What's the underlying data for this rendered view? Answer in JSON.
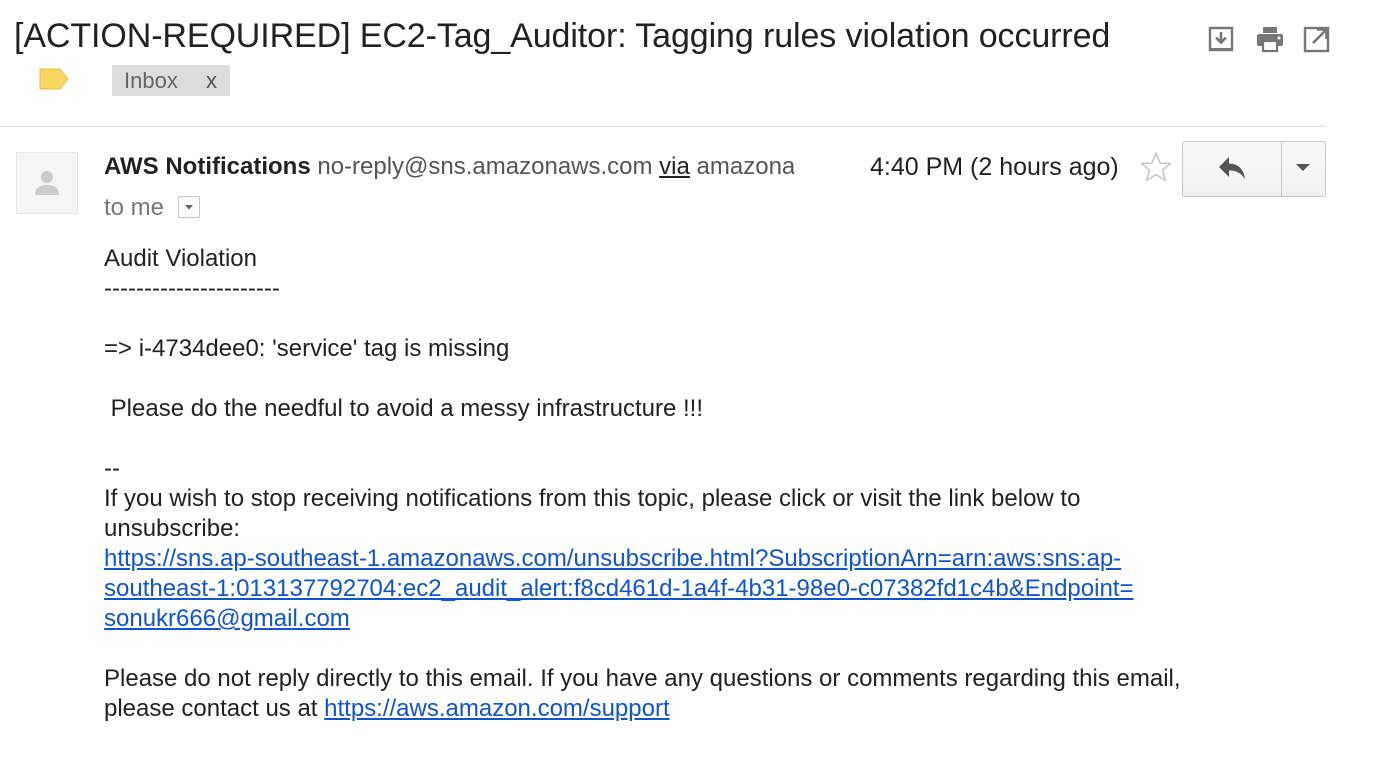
{
  "email": {
    "subject": "[ACTION-REQUIRED] EC2-Tag_Auditor: Tagging rules violation occurred",
    "label_chip": {
      "text": "Inbox",
      "remove": "x"
    },
    "sender": {
      "name": "AWS Notifications",
      "email": "no-reply@sns.amazonaws.com",
      "via": "via",
      "via_domain": "amazonaws.com"
    },
    "recipient": "to me",
    "timestamp": "4:40 PM (2 hours ago)",
    "body": {
      "heading": "Audit Violation",
      "rule": "----------------------",
      "violation": "=> i-4734dee0: 'service' tag is missing",
      "request": " Please do the needful to avoid a messy infrastructure !!!",
      "sig_sep": "--",
      "unsub_line1": "If you wish to stop receiving notifications from this topic, please click or visit the link below to",
      "unsub_line2": "unsubscribe:",
      "unsub_link_line1": "https://sns.ap-southeast-1.amazonaws.com/unsubscribe.html?SubscriptionArn=arn:aws:sns:ap-",
      "unsub_link_line2": "southeast-1:013137792704:ec2_audit_alert:f8cd461d-1a4f-4b31-98e0-c07382fd1c4b&Endpoint=",
      "unsub_link_line3": "sonukr666@gmail.com",
      "noreply_line1": "Please do not reply directly to this email. If you have any questions or comments regarding this email,",
      "noreply_line2_prefix": "please contact us at ",
      "support_link": "https://aws.amazon.com/support"
    }
  },
  "icons": {
    "toolbar": [
      "download-icon",
      "print-icon",
      "open-in-new-window-icon"
    ],
    "label": "label-tag-icon",
    "avatar": "person-icon",
    "star": "star-icon",
    "reply": "reply-icon",
    "more": "chevron-down-icon"
  },
  "colors": {
    "link": "#1155cc",
    "label_tag": "#f7d560",
    "chip_bg": "#dddddd",
    "icon": "#777777"
  }
}
